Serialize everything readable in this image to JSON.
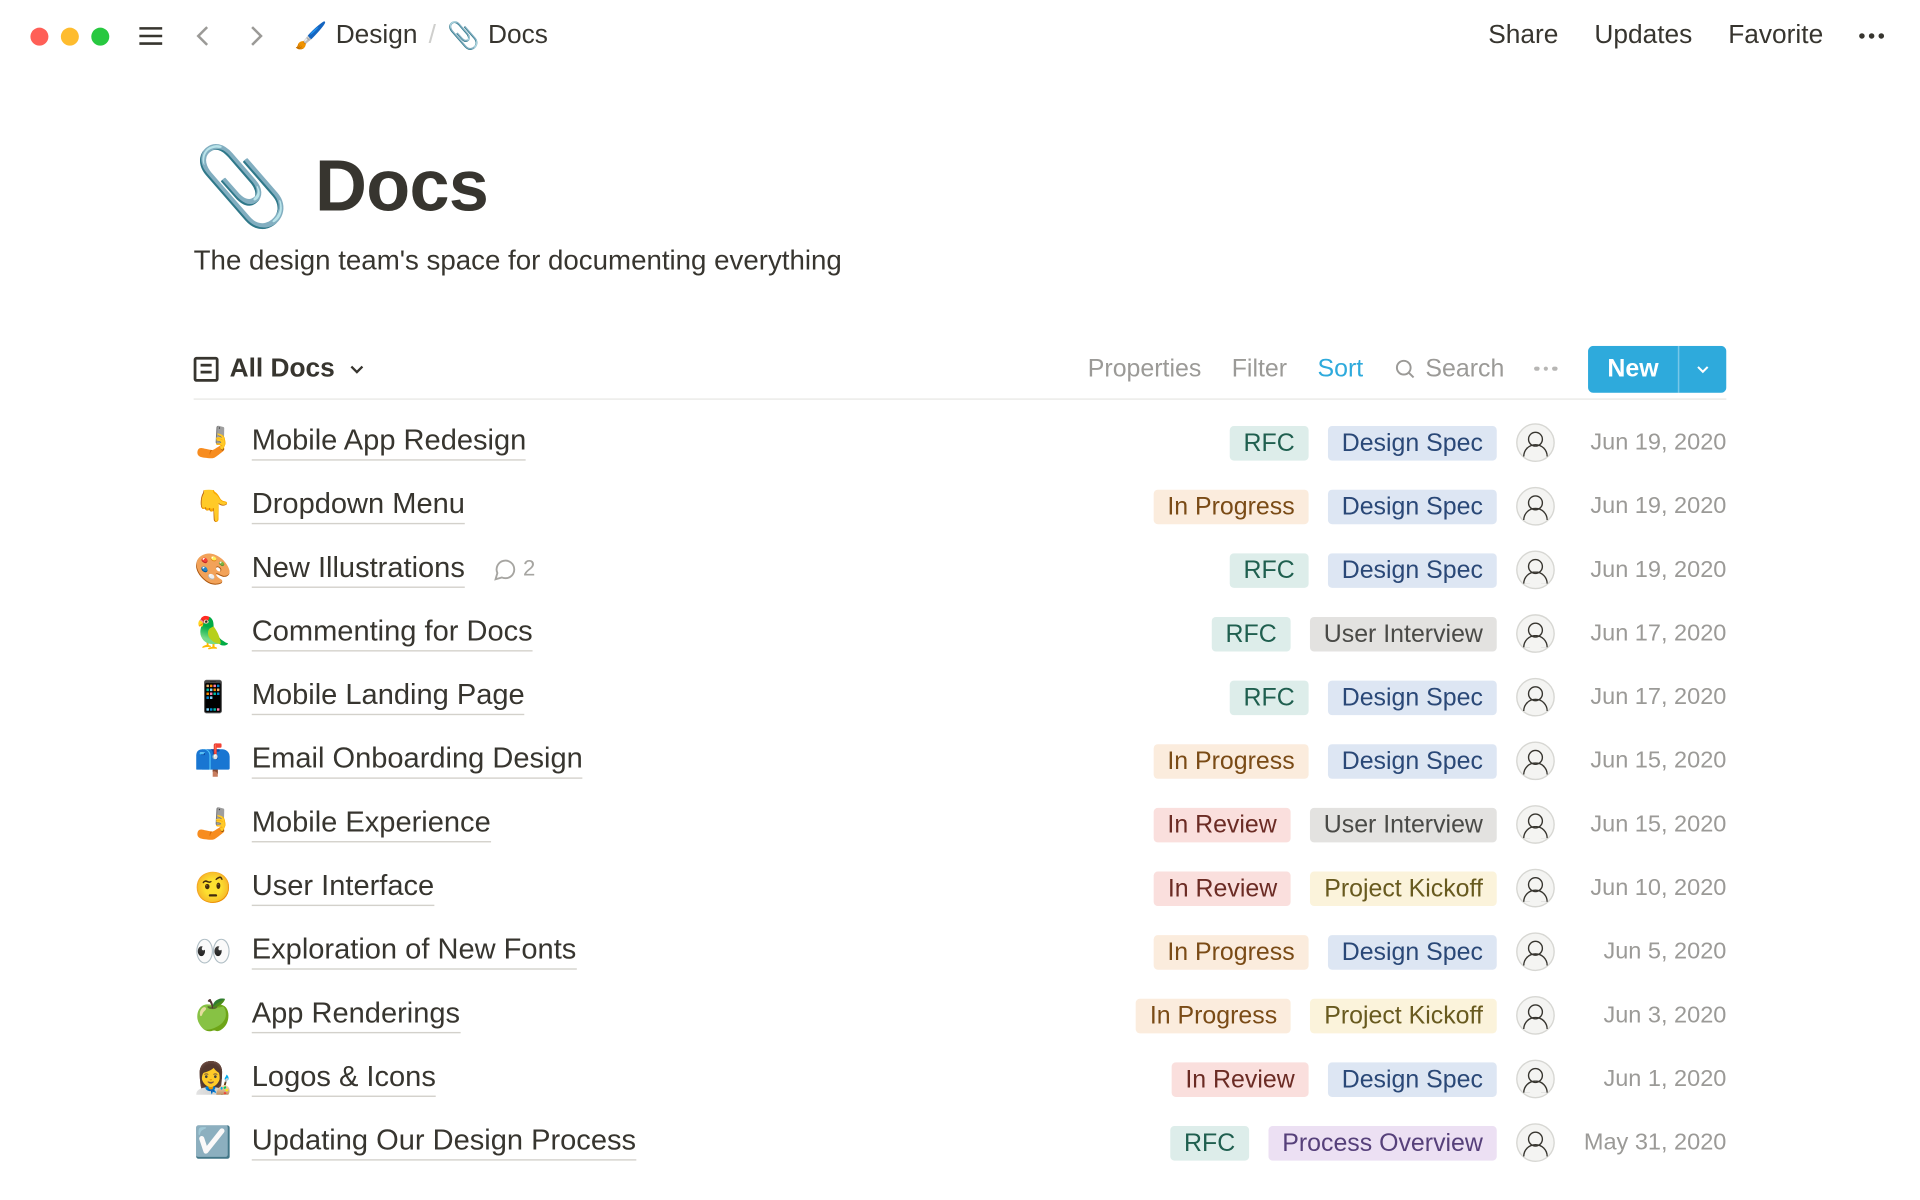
{
  "breadcrumb": {
    "parent": {
      "emoji": "🖌️",
      "label": "Design"
    },
    "current": {
      "emoji": "📎",
      "label": "Docs"
    }
  },
  "topbar": {
    "share": "Share",
    "updates": "Updates",
    "favorite": "Favorite"
  },
  "page": {
    "emoji": "📎",
    "title": "Docs",
    "subtitle": "The design team's space for documenting everything"
  },
  "viewbar": {
    "view_name": "All Docs",
    "properties": "Properties",
    "filter": "Filter",
    "sort": "Sort",
    "search": "Search",
    "new": "New"
  },
  "tag_styles": {
    "RFC": "tag-rfc",
    "In Progress": "tag-inprogress",
    "In Review": "tag-inreview",
    "Design Spec": "tag-designspec",
    "User Interview": "tag-userint",
    "Project Kickoff": "tag-kickoff",
    "Process Overview": "tag-process"
  },
  "rows": [
    {
      "emoji": "🤳",
      "title": "Mobile App Redesign",
      "tags": [
        "RFC",
        "Design Spec"
      ],
      "date": "Jun 19, 2020",
      "comments": null
    },
    {
      "emoji": "👇",
      "title": "Dropdown Menu",
      "tags": [
        "In Progress",
        "Design Spec"
      ],
      "date": "Jun 19, 2020",
      "comments": null
    },
    {
      "emoji": "🎨",
      "title": "New Illustrations",
      "tags": [
        "RFC",
        "Design Spec"
      ],
      "date": "Jun 19, 2020",
      "comments": 2
    },
    {
      "emoji": "🦜",
      "title": "Commenting for Docs",
      "tags": [
        "RFC",
        "User Interview"
      ],
      "date": "Jun 17, 2020",
      "comments": null
    },
    {
      "emoji": "📱",
      "title": "Mobile Landing Page",
      "tags": [
        "RFC",
        "Design Spec"
      ],
      "date": "Jun 17, 2020",
      "comments": null
    },
    {
      "emoji": "📫",
      "title": "Email Onboarding Design",
      "tags": [
        "In Progress",
        "Design Spec"
      ],
      "date": "Jun 15, 2020",
      "comments": null
    },
    {
      "emoji": "🤳",
      "title": "Mobile Experience",
      "tags": [
        "In Review",
        "User Interview"
      ],
      "date": "Jun 15, 2020",
      "comments": null
    },
    {
      "emoji": "🤨",
      "title": "User Interface",
      "tags": [
        "In Review",
        "Project Kickoff"
      ],
      "date": "Jun 10, 2020",
      "comments": null
    },
    {
      "emoji": "👀",
      "title": "Exploration of New Fonts",
      "tags": [
        "In Progress",
        "Design Spec"
      ],
      "date": "Jun 5, 2020",
      "comments": null
    },
    {
      "emoji": "🍏",
      "title": "App Renderings",
      "tags": [
        "In Progress",
        "Project Kickoff"
      ],
      "date": "Jun 3, 2020",
      "comments": null
    },
    {
      "emoji": "👩‍🎨",
      "title": "Logos & Icons",
      "tags": [
        "In Review",
        "Design Spec"
      ],
      "date": "Jun 1, 2020",
      "comments": null
    },
    {
      "emoji": "☑️",
      "title": "Updating Our Design Process",
      "tags": [
        "RFC",
        "Process Overview"
      ],
      "date": "May 31, 2020",
      "comments": null
    }
  ]
}
